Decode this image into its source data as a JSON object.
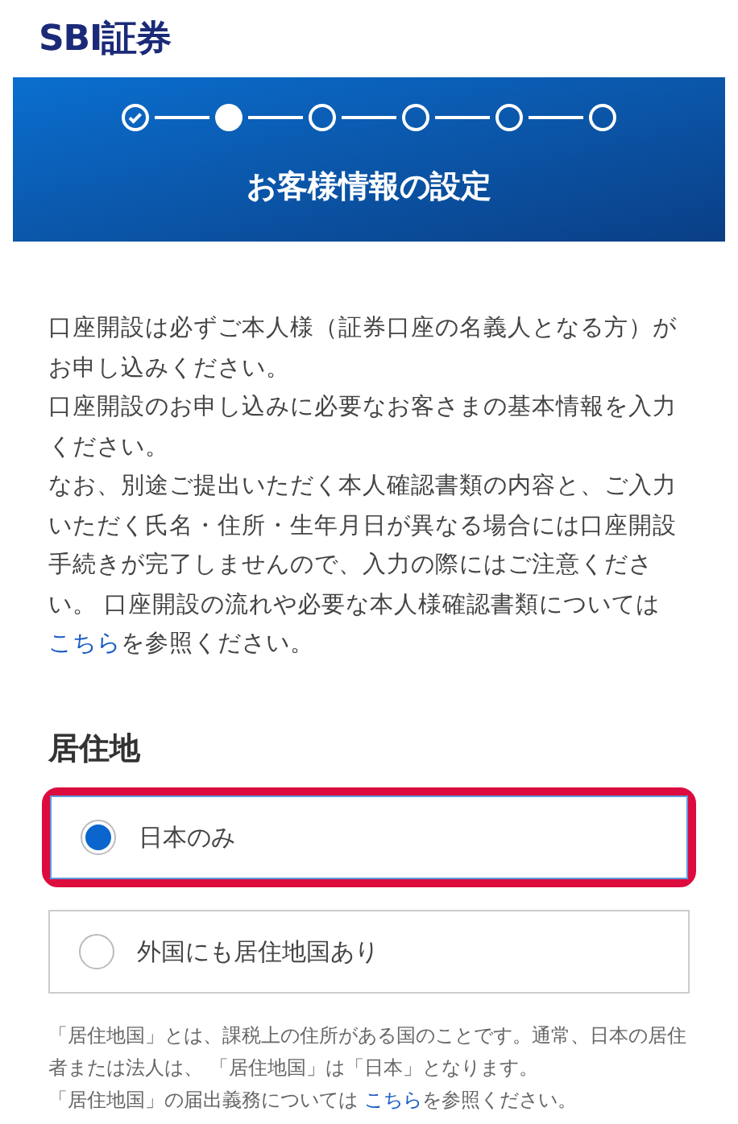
{
  "logo": "SBI証券",
  "steps": [
    {
      "completed": true,
      "current": false
    },
    {
      "completed": false,
      "current": true
    },
    {
      "completed": false,
      "current": false
    },
    {
      "completed": false,
      "current": false
    },
    {
      "completed": false,
      "current": false
    },
    {
      "completed": false,
      "current": false
    }
  ],
  "banner_title": "お客様情報の設定",
  "intro": {
    "paragraphs": [
      "口座開設は必ずご本人様（証券口座の名義人となる方）がお申し込みください。",
      "口座開設のお申し込みに必要なお客さまの基本情報を入力ください。"
    ],
    "last_before": "なお、別途ご提出いただく本人確認書類の内容と、ご入力いただく氏名・住所・生年月日が異なる場合には口座開設手続きが完了しませんので、入力の際にはご注意ください。 口座開設の流れや必要な本人様確認書類については",
    "last_link": "こちら",
    "last_after": "を参照ください。"
  },
  "section_title": "居住地",
  "options": [
    {
      "label": "日本のみ",
      "selected": true,
      "highlighted": true
    },
    {
      "label": "外国にも居住地国あり",
      "selected": false,
      "highlighted": false
    }
  ],
  "note": {
    "lines": [
      "「居住地国」とは、課税上の住所がある国のことです。通常、日本の居住者または法人は、 「居住地国」は「日本」となります。"
    ],
    "before": "「居住地国」の届出義務については ",
    "link": "こちら",
    "after": "を参照ください。"
  }
}
